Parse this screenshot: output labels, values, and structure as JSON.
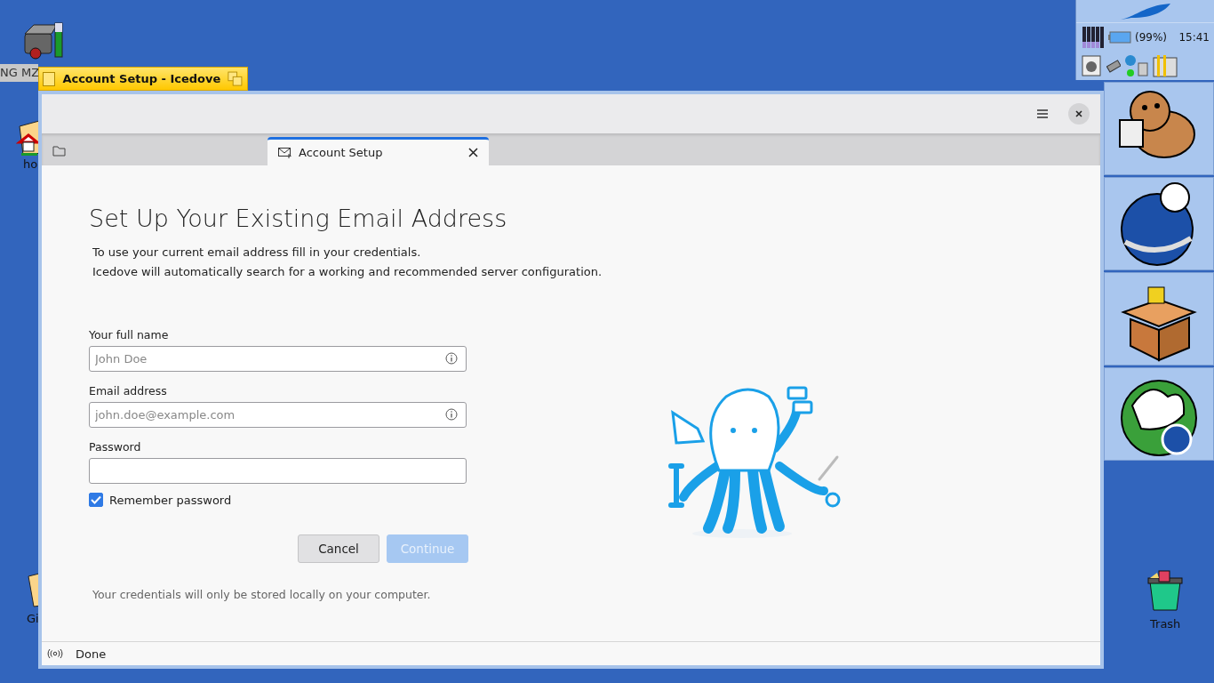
{
  "desktop_icons": [
    {
      "kind": "drive",
      "label": "NG MZ"
    },
    {
      "kind": "home",
      "label": "ho"
    },
    {
      "kind": "folder",
      "label": "Gi"
    },
    {
      "kind": "trash",
      "label": "Trash"
    }
  ],
  "tray": {
    "battery": "(99%)",
    "clock": "15:41"
  },
  "window": {
    "title": "Account Setup - Icedove"
  },
  "tabs": [
    {
      "kind": "folder",
      "selected": false
    },
    {
      "kind": "page",
      "label": "Account Setup",
      "selected": true
    }
  ],
  "form": {
    "heading": "Set Up Your Existing Email Address",
    "intro": [
      "To use your current email address fill in your credentials.",
      "Icedove will automatically search for a working and recommended server configuration."
    ],
    "fields": [
      {
        "label": "Your full name",
        "placeholder": "John Doe",
        "info": true
      },
      {
        "label": "Email address",
        "placeholder": "john.doe@example.com",
        "info": true
      },
      {
        "label": "Password",
        "info": false
      }
    ],
    "remember": {
      "label": "Remember password",
      "checked": true
    },
    "buttons": [
      {
        "label": "Cancel",
        "disabled": false,
        "primary": false
      },
      {
        "label": "Continue",
        "disabled": true,
        "primary": true
      }
    ],
    "note": "Your credentials will only be stored locally on your computer."
  },
  "status_bar": {
    "text": "Done"
  }
}
